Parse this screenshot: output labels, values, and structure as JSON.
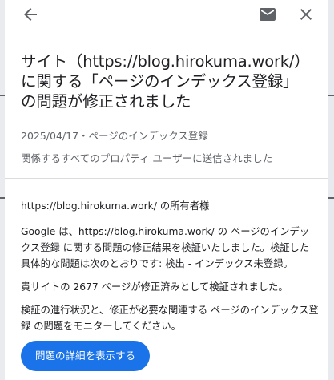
{
  "header": {
    "back_icon": "arrow-left-icon",
    "mail_icon": "mail-icon",
    "close_icon": "close-icon"
  },
  "notification": {
    "title": "サイト（https://blog.hirokuma.work/）に関する「ページのインデックス登録」の問題が修正されました",
    "meta": "2025/04/17・ページのインデックス登録",
    "sent_to": "関係するすべてのプロパティ ユーザーに送信されました"
  },
  "body": {
    "greeting": "https://blog.hirokuma.work/ の所有者様",
    "para1": "Google は、https://blog.hirokuma.work/ の ページのインデックス登録 に関する問題の修正結果を検証いたしました。検証した具体的な問題は次のとおりです: 検出 - インデックス未登録。",
    "para2": "貴サイトの 2677 ページが修正済みとして検証されました。",
    "para3": "検証の進行状況と、修正が必要な関連する ページのインデックス登録 の問題をモニターしてください。"
  },
  "cta": {
    "label": "問題の詳細を表示する",
    "color": "#1a73e8"
  }
}
